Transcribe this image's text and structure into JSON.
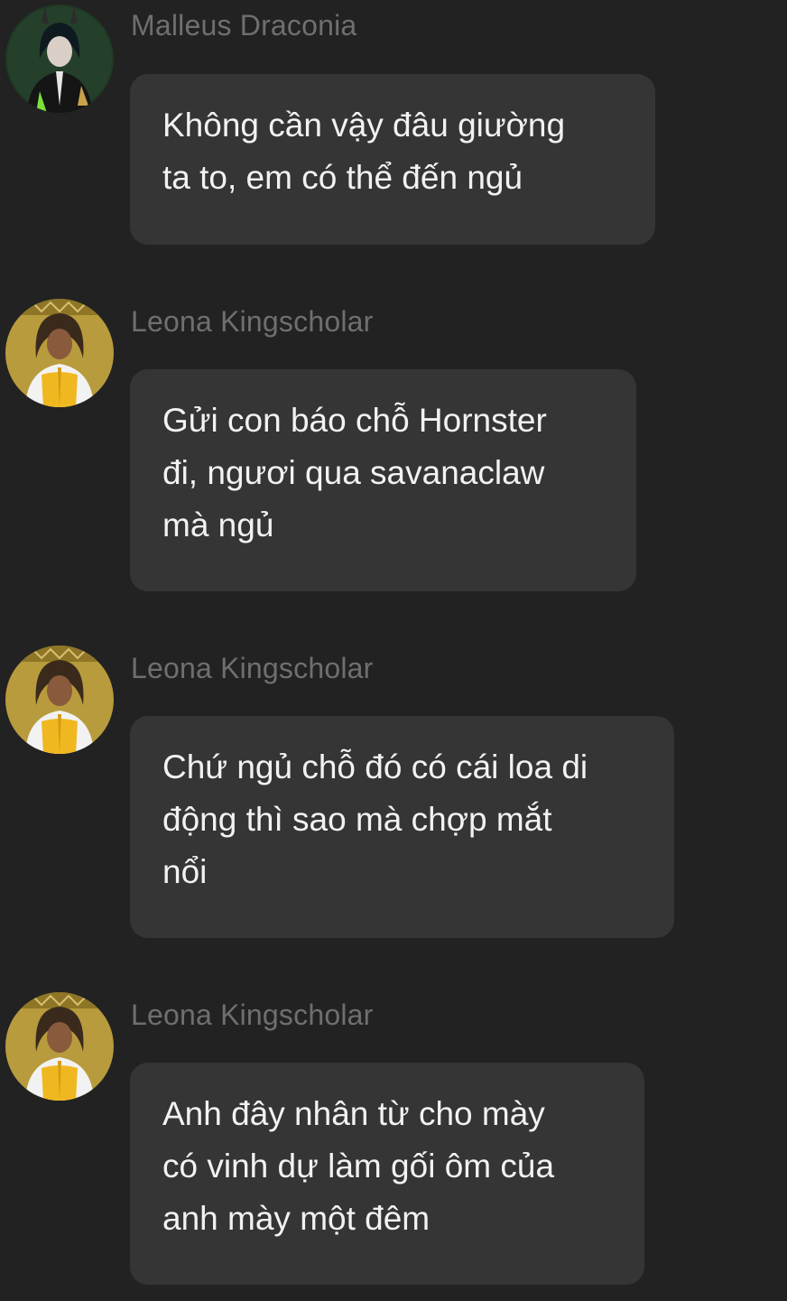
{
  "messages": [
    {
      "sender": "Malleus Draconia",
      "avatar_icon": "malleus-avatar-icon",
      "text": "Không cần vậy đâu giường\nta to, em có thể đến ngủ"
    },
    {
      "sender": "Leona Kingscholar",
      "avatar_icon": "leona-avatar-icon",
      "text": "Gửi con báo chỗ Hornster\nđi, ngươi qua savanaclaw\nmà ngủ"
    },
    {
      "sender": "Leona Kingscholar",
      "avatar_icon": "leona-avatar-icon",
      "text": "Chứ ngủ chỗ đó có cái loa di\nđộng thì sao mà chợp mắt\nnổi"
    },
    {
      "sender": "Leona Kingscholar",
      "avatar_icon": "leona-avatar-icon",
      "text": "Anh đây nhân từ cho mày\ncó vinh dự làm gối ôm của\nanh mày một đêm"
    }
  ],
  "colors": {
    "background": "#222222",
    "bubble": "#353535",
    "sender_name": "#6f6f6f",
    "message_text": "#f2f2f2"
  }
}
